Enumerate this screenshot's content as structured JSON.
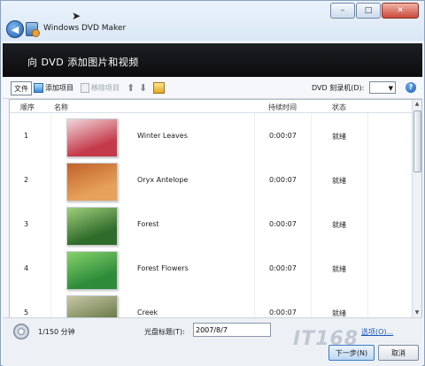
{
  "window": {
    "title": "Windows DVD Maker",
    "back_glyph": "◀",
    "minimize_glyph": "–",
    "maximize_glyph": "□",
    "close_glyph": "✕"
  },
  "header": {
    "heading": "向 DVD 添加图片和视频"
  },
  "toolbar": {
    "file_label": "文件",
    "add_label": "添加项目",
    "remove_label": "移除项目",
    "up_glyph": "⬆",
    "down_glyph": "⬇",
    "dvd_burner_label": "DVD 刻录机(D):",
    "help_glyph": "?"
  },
  "columns": {
    "order": "顺序",
    "name": "名称",
    "duration": "持续时间",
    "status": "状态"
  },
  "items": [
    {
      "num": "1",
      "name": "Winter Leaves",
      "duration": "0:00:07",
      "status": "就绪",
      "thumb_colors": [
        "#c43a4a",
        "#f0d7dc"
      ]
    },
    {
      "num": "2",
      "name": "Oryx Antelope",
      "duration": "0:00:07",
      "status": "就绪",
      "thumb_colors": [
        "#e7a15a",
        "#c0622a"
      ]
    },
    {
      "num": "3",
      "name": "Forest",
      "duration": "0:00:07",
      "status": "就绪",
      "thumb_colors": [
        "#2f6b2a",
        "#9fcf7a"
      ]
    },
    {
      "num": "4",
      "name": "Forest Flowers",
      "duration": "0:00:07",
      "status": "就绪",
      "thumb_colors": [
        "#2e8b3a",
        "#86d26a"
      ]
    },
    {
      "num": "5",
      "name": "Creek",
      "duration": "0:00:07",
      "status": "就绪",
      "thumb_colors": [
        "#6b7c4a",
        "#c9c7a6"
      ]
    }
  ],
  "footer": {
    "capacity": "1/150 分钟",
    "disc_title_label": "光盘标题(T):",
    "disc_title_value": "2007/8/7",
    "options_link": "选项(O)...",
    "next_label": "下一步(N)",
    "cancel_label": "取消",
    "watermark": "IT168"
  }
}
